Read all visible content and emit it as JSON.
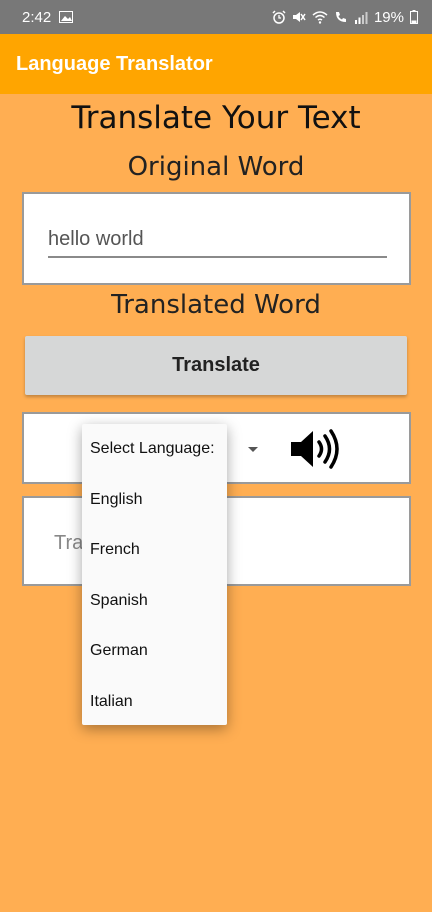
{
  "status_bar": {
    "time": "2:42",
    "battery": "19%"
  },
  "app_bar": {
    "title": "Language Translator"
  },
  "heading": "Translate Your Text",
  "original_label": "Original Word",
  "original_input": {
    "value": "hello world"
  },
  "translated_label": "Translated Word",
  "translate_button": "Translate",
  "output": {
    "placeholder_visible": "Tra"
  },
  "language_dropdown": {
    "items": [
      "Select Language:",
      "English",
      "French",
      "Spanish",
      "German",
      "Italian"
    ]
  },
  "icons": {
    "speaker": "speaker-icon"
  },
  "colors": {
    "background": "#FFAE52",
    "app_bar": "#FFA500",
    "status_bar": "#787878",
    "button": "#D6D7D7"
  }
}
